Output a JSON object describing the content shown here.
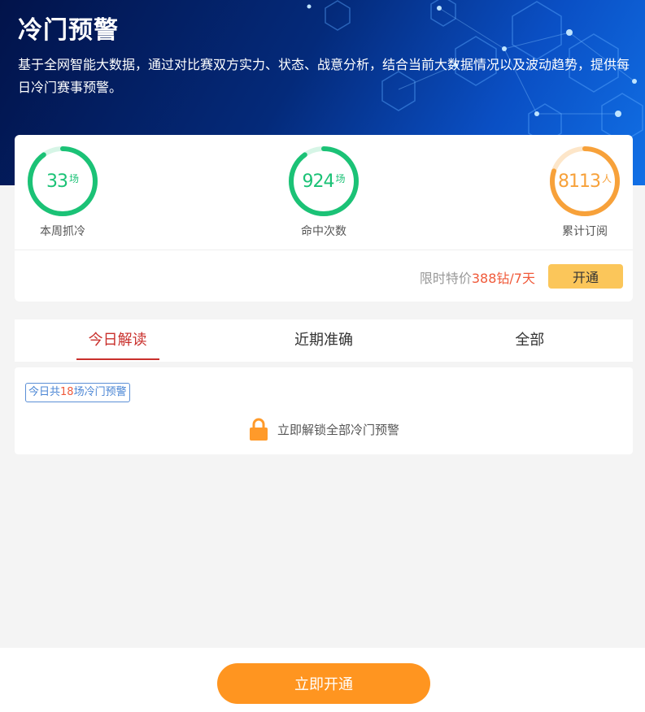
{
  "header": {
    "title": "冷门预警",
    "description": "基于全网智能大数据，通过对比赛双方实力、状态、战意分析，结合当前大数据情况以及波动趋势，提供每日冷门赛事预警。"
  },
  "stats": [
    {
      "value": "33",
      "unit": "场",
      "label": "本周抓冷",
      "progress": 0.9,
      "color": "#1bc276",
      "track": "#d6f5e6"
    },
    {
      "value": "924",
      "unit": "场",
      "label": "命中次数",
      "progress": 0.9,
      "color": "#1bc276",
      "track": "#d6f5e6"
    },
    {
      "value": "8113",
      "unit": "人",
      "label": "累计订阅",
      "progress": 0.8,
      "color": "#f7a13a",
      "track": "#fde6c9"
    }
  ],
  "price": {
    "prefix": "限时特价",
    "highlight": "388钻/7天"
  },
  "open_button": "开通",
  "tabs": [
    {
      "label": "今日解读",
      "active": true
    },
    {
      "label": "近期准确",
      "active": false
    },
    {
      "label": "全部",
      "active": false
    }
  ],
  "today": {
    "badge_prefix": "今日共",
    "badge_count": "18",
    "badge_suffix": "场冷门预警",
    "unlock_text": "立即解锁全部冷门预警"
  },
  "cta_label": "立即开通",
  "colors": {
    "accent_red": "#c9302c",
    "accent_orange": "#ff9520",
    "highlight": "#f05a3a"
  }
}
